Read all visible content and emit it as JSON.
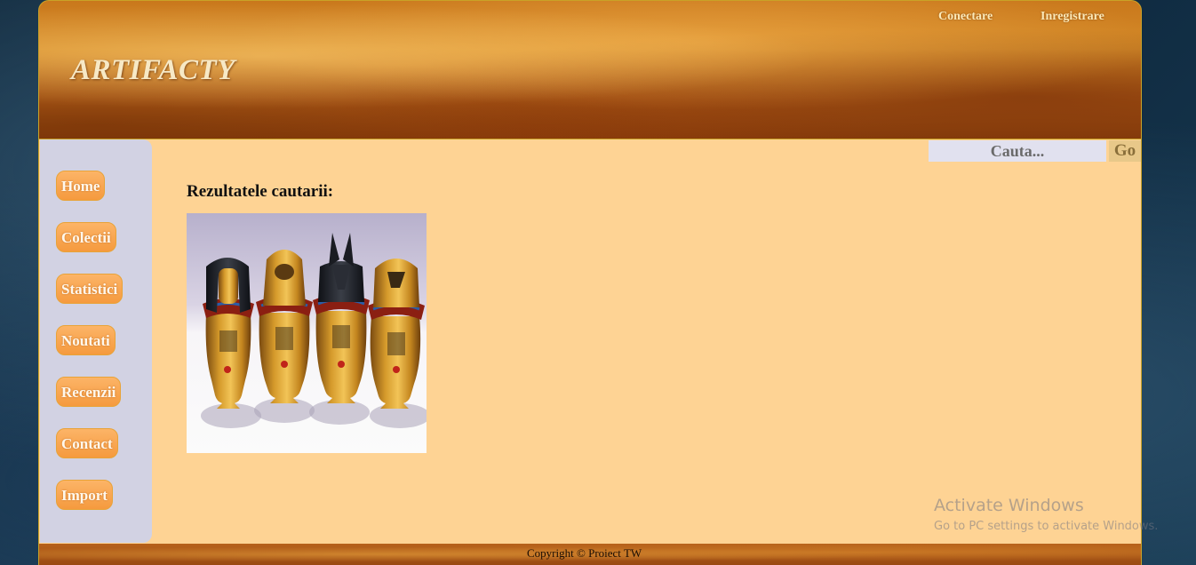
{
  "header": {
    "logo": "ARTIFACTY",
    "links": {
      "login": "Conectare",
      "register": "Inregistrare"
    }
  },
  "sidebar": {
    "items": [
      {
        "label": "Home"
      },
      {
        "label": "Colectii"
      },
      {
        "label": "Statistici"
      },
      {
        "label": "Noutati"
      },
      {
        "label": "Recenzii"
      },
      {
        "label": "Contact"
      },
      {
        "label": "Import"
      }
    ]
  },
  "search": {
    "placeholder": "Cauta...",
    "button_label": "Go"
  },
  "main": {
    "results_title": "Rezultatele cautarii:"
  },
  "footer": {
    "copyright": "Copyright © Proiect TW"
  },
  "watermark": {
    "title": "Activate Windows",
    "subtitle": "Go to PC settings to activate Windows."
  },
  "colors": {
    "content_bg": "#fed394",
    "sidebar_bg": "#d2d2e3",
    "nav_button": "#f59a3e",
    "border_gold": "#c9a227"
  }
}
